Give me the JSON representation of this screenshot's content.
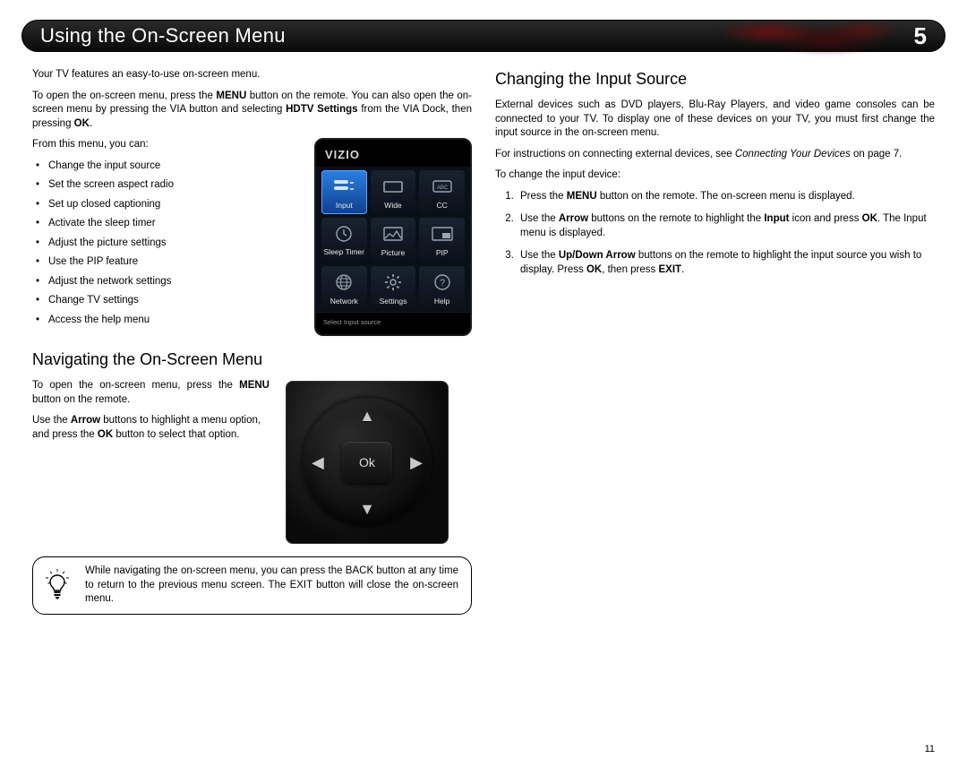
{
  "header": {
    "title": "Using the On-Screen Menu",
    "chapter": "5"
  },
  "left": {
    "intro1": "Your TV features an easy-to-use on-screen menu.",
    "intro2_a": "To open the on-screen menu, press the ",
    "intro2_menu": "MENU",
    "intro2_b": " button on the remote. You can also open the on-screen menu by pressing the VIA button and selecting ",
    "intro2_hdtv": "HDTV Settings",
    "intro2_c": " from the VIA Dock, then pressing ",
    "intro2_ok": "OK",
    "intro2_d": ".",
    "from_list": "From this menu, you can:",
    "features": [
      "Change the input source",
      "Set the screen aspect radio",
      "Set up closed captioning",
      "Activate the sleep timer",
      "Adjust the picture settings",
      "Use the PIP feature",
      "Adjust the network settings",
      "Change TV settings",
      "Access the help menu"
    ],
    "tv": {
      "brand": "VIZIO",
      "tiles": [
        "Input",
        "Wide",
        "CC",
        "Sleep Timer",
        "Picture",
        "PIP",
        "Network",
        "Settings",
        "Help"
      ],
      "footer": "Select Input source"
    },
    "nav_heading": "Navigating the On-Screen Menu",
    "nav1_a": "To open the on-screen menu, press the ",
    "nav1_menu": "MENU",
    "nav1_b": " button on the remote.",
    "nav2_a": "Use the ",
    "nav2_arrow": "Arrow",
    "nav2_b": " buttons to highlight a menu option, and press the ",
    "nav2_ok": "OK",
    "nav2_c": " button to select that option.",
    "remote_ok": "Ok",
    "tip": "While navigating the on-screen menu, you can press the BACK button at any time to return to the previous menu screen. The EXIT button will close the on-screen menu."
  },
  "right": {
    "heading": "Changing the Input Source",
    "p1": "External devices such as DVD players, Blu-Ray Players, and video game consoles can be connected to your TV. To display one of these devices on your TV, you must first change the input source in the on-screen menu.",
    "p2_a": "For instructions on connecting external devices, see ",
    "p2_i": "Connecting Your Devices",
    "p2_b": " on page 7.",
    "p3": "To change the input device:",
    "s1_a": "Press the ",
    "s1_menu": "MENU",
    "s1_b": " button on the remote. The on-screen menu is displayed.",
    "s2_a": "Use the ",
    "s2_arrow": "Arrow",
    "s2_b": " buttons on the remote to highlight the ",
    "s2_input": "Input",
    "s2_c": " icon and press ",
    "s2_ok": "OK",
    "s2_d": ". The Input menu is displayed.",
    "s3_a": "Use the ",
    "s3_ud": "Up/Down Arrow",
    "s3_b": " buttons on the remote to highlight the input source you wish to display. Press ",
    "s3_ok": "OK",
    "s3_c": ", then press ",
    "s3_exit": "EXIT",
    "s3_d": "."
  },
  "page_number": "11"
}
